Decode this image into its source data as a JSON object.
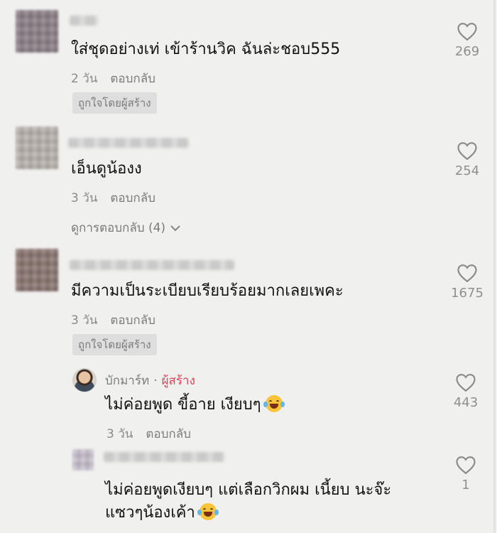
{
  "comments": [
    {
      "text": "ใส่ชุดอย่างเท่ เข้าร้านวิค ฉันล่ะชอบ555",
      "time": "2 วัน",
      "reply": "ตอบกลับ",
      "badge": "ถูกใจโดยผู้สร้าง",
      "likes": "269"
    },
    {
      "text": "เอ็นดูน้องง",
      "time": "3 วัน",
      "reply": "ตอบกลับ",
      "view_replies": "ดูการตอบกลับ (4)",
      "likes": "254"
    },
    {
      "text": "มีความเป็นระเบียบเรียบร้อยมากเลยเพคะ",
      "time": "3 วัน",
      "reply": "ตอบกลับ",
      "badge": "ถูกใจโดยผู้สร้าง",
      "likes": "1675"
    }
  ],
  "creator_reply": {
    "name": "บักมาร์ท",
    "separator": "·",
    "tag": "ผู้สร้าง",
    "text": "ไม่ค่อยพูด ขี้อาย เงียบๆ",
    "time": "3 วัน",
    "reply": "ตอบกลับ",
    "likes": "443"
  },
  "reply_2": {
    "line1": "ไม่ค่อยพูดเงียบๆ แต่เลือกวิกผม เนี้ยบ นะจ๊ะ",
    "line2": "แซวๆน้องเค้า",
    "likes": "1"
  },
  "icons": {
    "like": "heart-outline-icon",
    "expand": "chevron-down-icon",
    "emoji": "tears-of-joy-emoji"
  }
}
